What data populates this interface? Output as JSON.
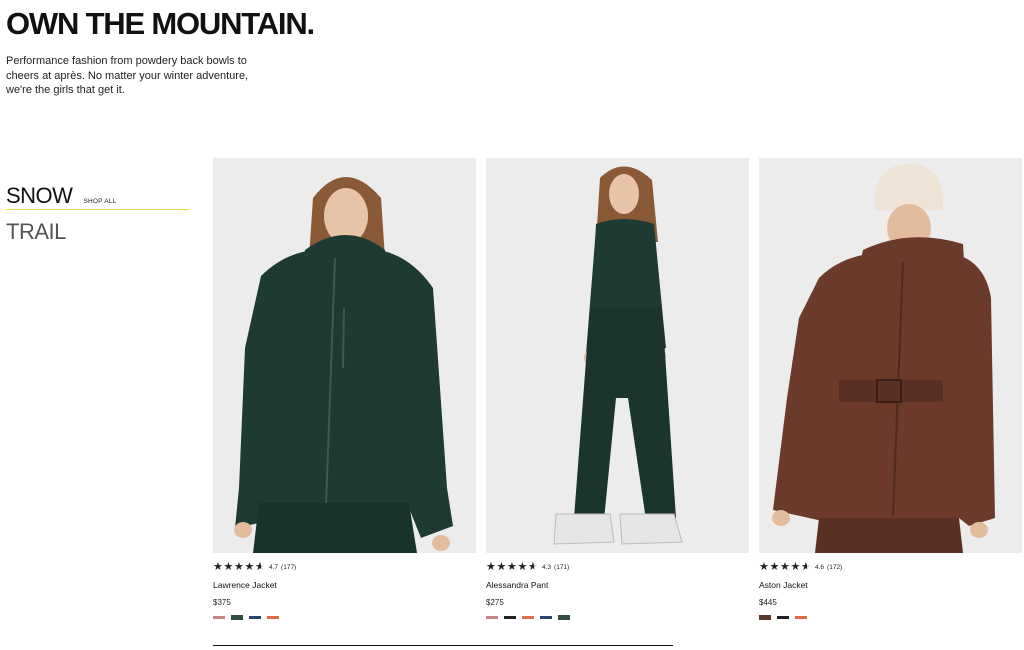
{
  "hero": {
    "title": "OWN THE MOUNTAIN.",
    "copy": "Performance fashion from powdery back bowls to cheers at après. No matter your winter adventure, we're the girls that get it."
  },
  "categories": {
    "snow": "SNOW",
    "shop_all": "SHOP ALL",
    "trail": "TRAIL",
    "accent_color": "#f2d84a"
  },
  "products": [
    {
      "name": "Lawrence Jacket",
      "price": "$375",
      "rating": "4.7",
      "count": "(177)",
      "stars": 4.7,
      "swatches": [
        "#c98282",
        "#2f4d42",
        "#29456a",
        "#e06a4a"
      ],
      "garment_color": "#1f3a33"
    },
    {
      "name": "Alessandra Pant",
      "price": "$275",
      "rating": "4.3",
      "count": "(171)",
      "stars": 4.3,
      "swatches": [
        "#c98282",
        "#222222",
        "#e06a4a",
        "#29456a",
        "#2f4d42"
      ],
      "garment_color": "#1f3a33"
    },
    {
      "name": "Aston Jacket",
      "price": "$445",
      "rating": "4.6",
      "count": "(172)",
      "stars": 4.6,
      "swatches": [
        "#5a3a2c",
        "#222222",
        "#e06a4a"
      ],
      "garment_color": "#6b3a2a"
    }
  ]
}
